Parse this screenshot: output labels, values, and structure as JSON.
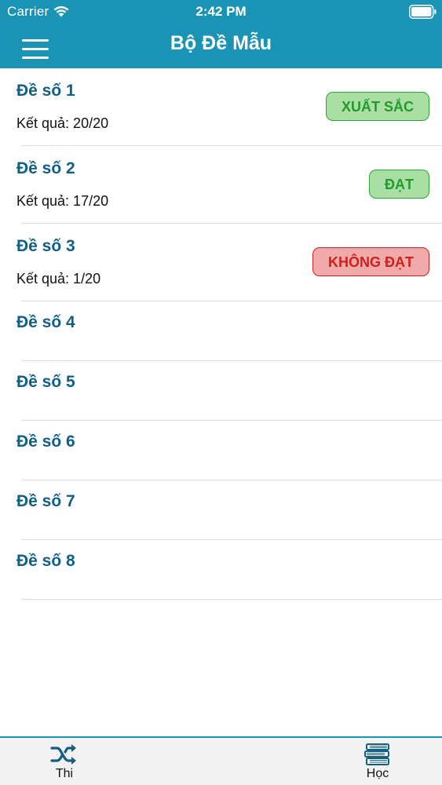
{
  "status_bar": {
    "carrier": "Carrier",
    "time": "2:42 PM"
  },
  "nav": {
    "title": "Bộ Đề Mẫu",
    "menu_icon": "hamburger-menu-icon"
  },
  "colors": {
    "header_bg": "#1a93b4",
    "title_text": "#0f5f86",
    "good_badge_bg": "#a9dea4",
    "good_badge_text": "#239a2c",
    "bad_badge_bg": "#f0aaaa",
    "bad_badge_text": "#cf1f1f"
  },
  "exams": [
    {
      "title": "Đề số 1",
      "result": "Kết quả: 20/20",
      "badge": "XUẤT SẮC",
      "status": "good"
    },
    {
      "title": "Đề số 2",
      "result": "Kết quả: 17/20",
      "badge": "ĐẠT",
      "status": "good"
    },
    {
      "title": "Đề số 3",
      "result": "Kết quả: 1/20",
      "badge": "KHÔNG ĐẠT",
      "status": "bad"
    },
    {
      "title": "Đề số 4"
    },
    {
      "title": "Đề số 5"
    },
    {
      "title": "Đề số 6"
    },
    {
      "title": "Đề số 7"
    },
    {
      "title": "Đề số 8"
    }
  ],
  "tabs": [
    {
      "label": "Thi",
      "icon": "shuffle-icon"
    },
    {
      "label": "Học",
      "icon": "books-icon"
    }
  ]
}
